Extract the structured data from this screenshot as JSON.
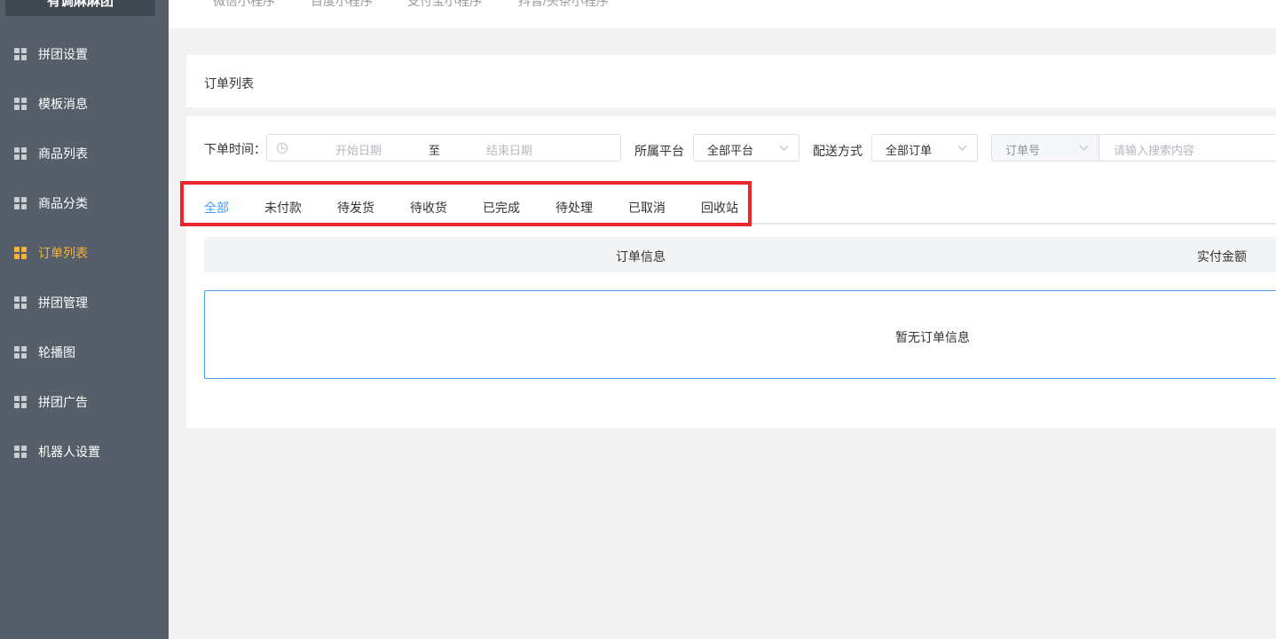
{
  "sidebar": {
    "brand": "有调麻麻团",
    "items": [
      {
        "label": "拼团设置"
      },
      {
        "label": "模板消息"
      },
      {
        "label": "商品列表"
      },
      {
        "label": "商品分类"
      },
      {
        "label": "订单列表"
      },
      {
        "label": "拼团管理"
      },
      {
        "label": "轮播图"
      },
      {
        "label": "拼团广告"
      },
      {
        "label": "机器人设置"
      }
    ],
    "active_item": "订单列表"
  },
  "topbar": {
    "tabs": [
      "微信小程序",
      "百度小程序",
      "支付宝小程序",
      "抖音/头条小程序"
    ]
  },
  "page_title": "订单列表",
  "filters": {
    "order_time_label": "下单时间：",
    "start_date_placeholder": "开始日期",
    "range_separator": "至",
    "end_date_placeholder": "结束日期",
    "platform_label": "所属平台",
    "platform_value": "全部平台",
    "delivery_label": "配送方式",
    "delivery_value": "全部订单",
    "search_field_value": "订单号",
    "search_placeholder": "请输入搜索内容"
  },
  "status_tabs": [
    "全部",
    "未付款",
    "待发货",
    "待收货",
    "已完成",
    "待处理",
    "已取消",
    "回收站"
  ],
  "active_status_tab": "全部",
  "table": {
    "columns": [
      "订单信息",
      "实付金额"
    ],
    "empty_text": "暂无订单信息"
  },
  "colors": {
    "sidebar_bg": "#565f69",
    "active_nav": "#f5b338",
    "active_tab": "#409eff",
    "highlight_box": "#e8262b"
  }
}
